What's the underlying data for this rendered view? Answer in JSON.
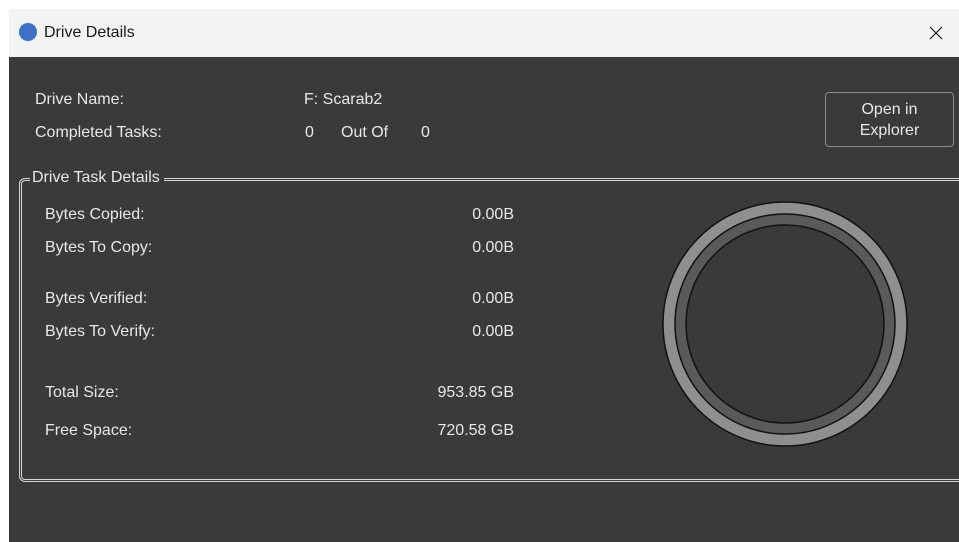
{
  "window": {
    "title": "Drive Details",
    "close_glyph": "✕"
  },
  "drive": {
    "name_label": "Drive Name:",
    "name_value": "F: Scarab2",
    "completed_label": "Completed Tasks:",
    "completed_count": "0",
    "out_of_label": "Out Of",
    "total_count": "0"
  },
  "open_button": {
    "label": "Open in Explorer"
  },
  "task_details": {
    "legend": "Drive Task Details",
    "rows": [
      {
        "label": "Bytes Copied:",
        "value": "0.00B"
      },
      {
        "label": "Bytes To Copy:",
        "value": "0.00B"
      },
      {
        "label": "Bytes Verified:",
        "value": "0.00B"
      },
      {
        "label": "Bytes To Verify:",
        "value": "0.00B"
      },
      {
        "label": "Total Size:",
        "value": "953.85 GB"
      },
      {
        "label": "Free Space:",
        "value": "720.58 GB"
      }
    ]
  },
  "gauge": {
    "progress_fraction": 0,
    "colors": {
      "outer_ring": "#8f8f8f",
      "inner_ring": "#5a5a5a",
      "center": "#3a3a3a",
      "stroke": "#111111"
    }
  },
  "colors": {
    "background": "#3a3a3a",
    "titlebar": "#f3f3f3",
    "text": "#e8e8e8",
    "app_icon": "#3f6fc6"
  },
  "icons": {
    "app": "app-circle-icon",
    "close": "close-icon"
  }
}
